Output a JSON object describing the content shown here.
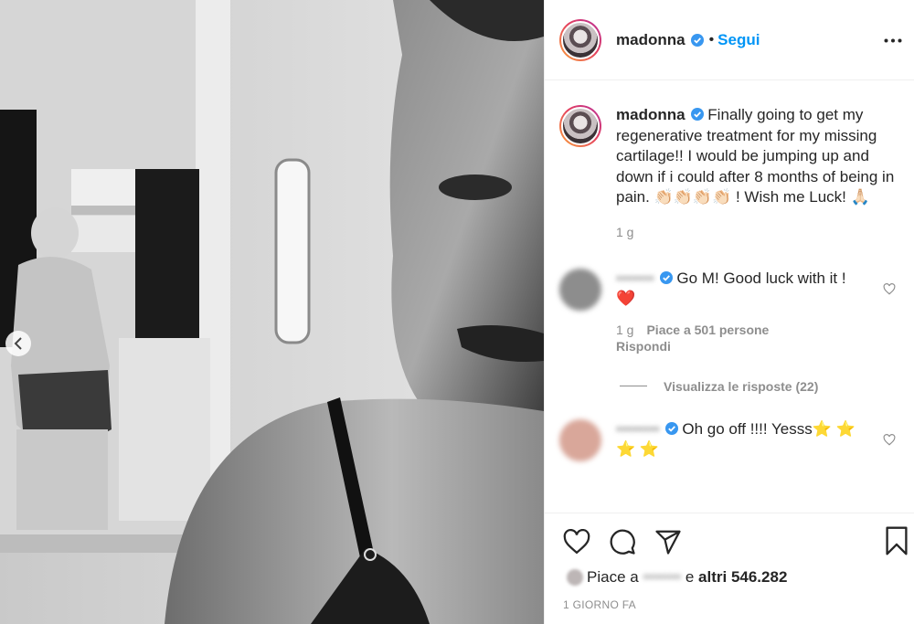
{
  "post": {
    "username": "madonna",
    "follow_label": "Segui",
    "caption_text": "Finally going to get my regenerative treatment for my missing cartilage!! I would be jumping up and down if i could after 8 months of being in pain. 👏🏻👏🏻👏🏻👏🏻 ! Wish me Luck! 🙏🏻",
    "caption_age": "1 g"
  },
  "comments": [
    {
      "username": "•••••••",
      "text": "Go M! Good luck with it ! ❤️",
      "age": "1 g",
      "likes": "Piace a 501 persone",
      "reply_label": "Rispondi",
      "view_replies": "Visualizza le risposte (22)"
    },
    {
      "username": "••••••••",
      "text": "Oh go off !!!! Yesss⭐ ⭐ ⭐ ⭐"
    }
  ],
  "footer": {
    "likes_prefix": "Piace a",
    "likes_blurred": "•••••••",
    "likes_middle": "e",
    "likes_count": "altri 546.282",
    "timestamp": "1 GIORNO FA"
  },
  "colors": {
    "accent_blue": "#0095f6",
    "verified_blue": "#3897f0",
    "muted": "#8e8e8e",
    "heart_red": "#ed4956"
  },
  "icons": {
    "carousel_prev": "chevron-left-icon",
    "more": "ellipsis-icon",
    "like": "heart-icon",
    "comment": "comment-bubble-icon",
    "share": "paper-plane-icon",
    "save": "bookmark-icon"
  }
}
